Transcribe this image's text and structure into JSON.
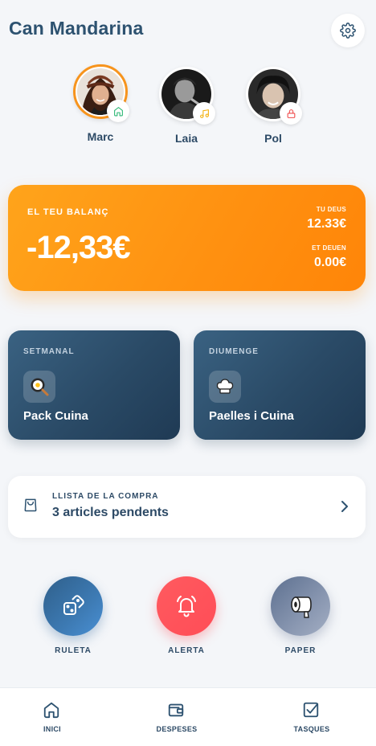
{
  "header": {
    "title": "Can Mandarina",
    "settings_icon": "gear-icon"
  },
  "members": [
    {
      "name": "Marc",
      "badge_icon": "home-icon",
      "badge_color": "#2bb673",
      "active": true
    },
    {
      "name": "Laia",
      "badge_icon": "music-note-icon",
      "badge_color": "#f2b10f",
      "active": false
    },
    {
      "name": "Pol",
      "badge_icon": "lock-icon",
      "badge_color": "#ef4b4b",
      "active": false
    }
  ],
  "balance": {
    "label": "EL TEU BALANÇ",
    "amount": "-12,33€",
    "owe_label": "TU DEUS",
    "owe_value": "12.33€",
    "owed_label": "ET DEUEN",
    "owed_value": "0.00€",
    "accent_color": "#ff9a12"
  },
  "tasks": [
    {
      "frequency": "SETMANAL",
      "name": "Pack Cuina",
      "icon": "frying-pan-icon"
    },
    {
      "frequency": "DIUMENGE",
      "name": "Paelles i Cuina",
      "icon": "chef-hat-icon"
    }
  ],
  "shopping": {
    "label": "LLISTA DE LA COMPRA",
    "count_text": "3 articles pendents",
    "icon": "shopping-bag-icon"
  },
  "actions": [
    {
      "label": "RULETA",
      "icon": "dice-icon",
      "color": "#3d7ab3"
    },
    {
      "label": "ALERTA",
      "icon": "bell-icon",
      "color": "#ff4d57"
    },
    {
      "label": "PAPER",
      "icon": "toilet-paper-icon",
      "color": "#8896b0"
    }
  ],
  "nav": [
    {
      "label": "INICI",
      "icon": "home-icon",
      "active": true
    },
    {
      "label": "DESPESES",
      "icon": "wallet-icon",
      "active": false
    },
    {
      "label": "TASQUES",
      "icon": "checkbox-icon",
      "active": false
    }
  ]
}
